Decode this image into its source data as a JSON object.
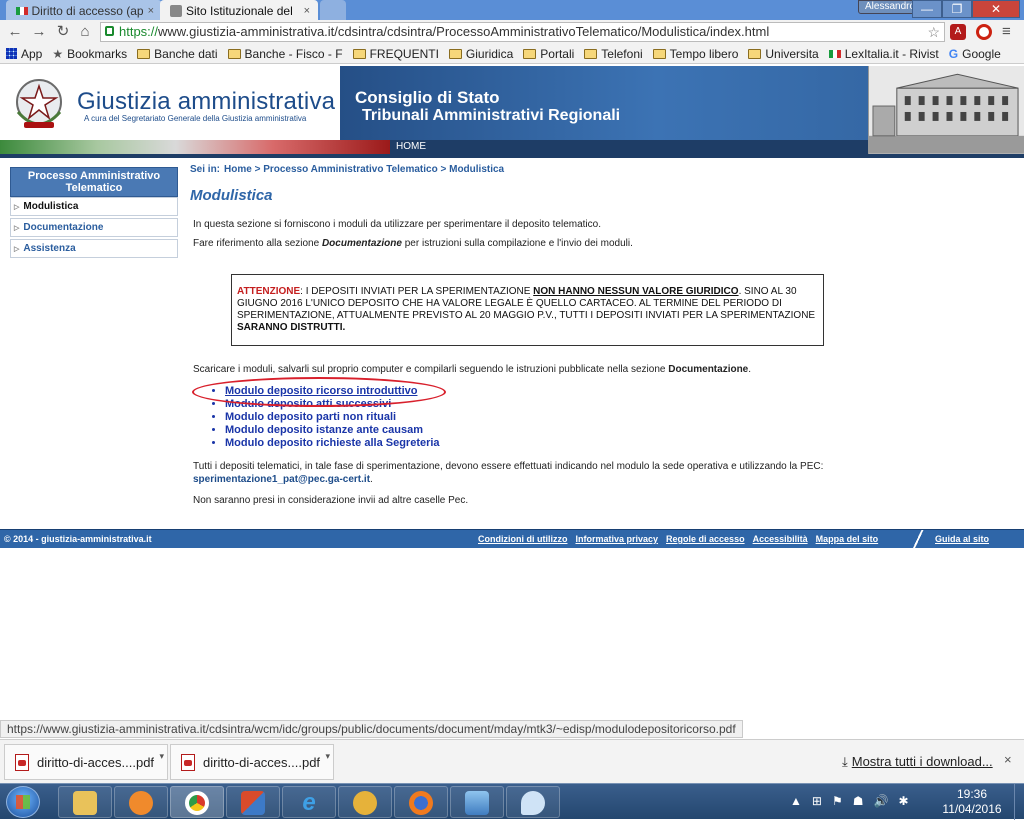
{
  "browser": {
    "tabs": [
      {
        "label": "Diritto di accesso (ap",
        "close": "×"
      },
      {
        "label": "Sito Istituzionale del",
        "close": "×"
      }
    ],
    "user": "Alessandro",
    "window_buttons": {
      "minimize": "—",
      "maximize": "❐",
      "close": "✕"
    },
    "nav": {
      "back": "←",
      "forward": "→",
      "reload": "↻",
      "home": "⌂"
    },
    "url_scheme": "https://",
    "url_rest": "www.giustizia-amministrativa.it/cdsintra/cdsintra/ProcessoAmministrativoTelematico/Modulistica/index.html",
    "star": "☆",
    "menu": "≡",
    "bookmarks": [
      {
        "label": "App",
        "icon": "apps-grid-icon"
      },
      {
        "label": "Bookmarks",
        "icon": "star-icon"
      },
      {
        "label": "Banche dati",
        "icon": "folder-icon"
      },
      {
        "label": "Banche - Fisco - F",
        "icon": "folder-icon"
      },
      {
        "label": "FREQUENTI",
        "icon": "folder-icon"
      },
      {
        "label": "Giuridica",
        "icon": "folder-icon"
      },
      {
        "label": "Portali",
        "icon": "folder-icon"
      },
      {
        "label": "Telefoni",
        "icon": "folder-icon"
      },
      {
        "label": "Tempo libero",
        "icon": "folder-icon"
      },
      {
        "label": "Universita",
        "icon": "folder-icon"
      },
      {
        "label": "LexItalia.it - Rivist",
        "icon": "italian-flag-icon"
      },
      {
        "label": "Google",
        "icon": "google-icon"
      }
    ]
  },
  "header": {
    "title": "Giustizia amministrativa",
    "subtitle": "A cura del Segretariato Generale della Giustizia amministrativa",
    "band_line1": "Consiglio di Stato",
    "band_line2": "Tribunali Amministrativi Regionali",
    "home": "HOME"
  },
  "sidebar": {
    "title": "Processo Amministrativo Telematico",
    "items": [
      {
        "label": "Modulistica"
      },
      {
        "label": "Documentazione"
      },
      {
        "label": "Assistenza"
      }
    ]
  },
  "main": {
    "breadcrumb": [
      "Sei in:",
      "Home >",
      "Processo Amministrativo Telematico",
      "> Modulistica"
    ],
    "title": "Modulistica",
    "intro1": "In questa sezione si forniscono i moduli da utilizzare per sperimentare il deposito telematico.",
    "intro2_a": "Fare riferimento alla sezione ",
    "intro2_b": "Documentazione",
    "intro2_c": " per istruzioni sulla compilazione e l'invio dei moduli.",
    "warning": {
      "label": "ATTENZIONE",
      "text1": ": I DEPOSITI INVIATI PER LA SPERIMENTAZIONE ",
      "emph": "NON HANNO NESSUN VALORE GIURIDICO",
      "text2": ". SINO AL 30 GIUGNO 2016 L'UNICO DEPOSITO CHE HA VALORE LEGALE È QUELLO CARTACEO. AL TERMINE DEL PERIODO DI SPERIMENTAZIONE, ATTUALMENTE PREVISTO AL 20 MAGGIO P.V., TUTTI I DEPOSITI INVIATI PER LA SPERIMENTAZIONE ",
      "end": "SARANNO DISTRUTTI."
    },
    "download_a": "Scaricare i moduli, salvarli sul proprio computer e compilarli seguendo le istruzioni pubblicate nella sezione ",
    "download_b": "Documentazione",
    "download_c": ".",
    "modules": [
      "Modulo deposito ricorso introduttivo",
      "Modulo deposito atti successivi",
      "Modulo deposito parti non rituali",
      "Modulo deposito istanze ante causam",
      "Modulo deposito richieste alla Segreteria"
    ],
    "pec_text": "Tutti i depositi telematici, in tale fase di sperimentazione, devono essere effettuati indicando nel modulo la sede operativa e utilizzando la PEC:",
    "pec_address": "sperimentazione1_pat@pec.ga-cert.it",
    "pec_dot": ".",
    "note": "Non saranno presi in considerazione invii ad altre caselle Pec."
  },
  "footer": {
    "copyright": "© 2014 - giustizia-amministrativa.it",
    "links": [
      "Condizioni di utilizzo",
      "Informativa privacy",
      "Regole di accesso",
      "Accessibilità",
      "Mappa del sito"
    ],
    "guide": "Guida al sito"
  },
  "status_url": "https://www.giustizia-amministrativa.it/cdsintra/wcm/idc/groups/public/documents/document/mday/mtk3/~edisp/modulodepositoricorso.pdf",
  "downloads": {
    "items": [
      "diritto-di-acces....pdf",
      "diritto-di-acces....pdf"
    ],
    "caret": "▾",
    "show_all": "Mostra tutti i download...",
    "close": "×"
  },
  "taskbar": {
    "apps": [
      "explorer-folder-icon",
      "media-player-icon",
      "chrome-icon",
      "office-app-icon",
      "internet-explorer-icon",
      "remote-app-icon",
      "firefox-icon",
      "photos-icon",
      "paint-icon"
    ],
    "tray": [
      "▲",
      "⊞",
      "⚑",
      "☗",
      "🔊",
      "✱"
    ],
    "time": "19:36",
    "date": "11/04/2016"
  }
}
